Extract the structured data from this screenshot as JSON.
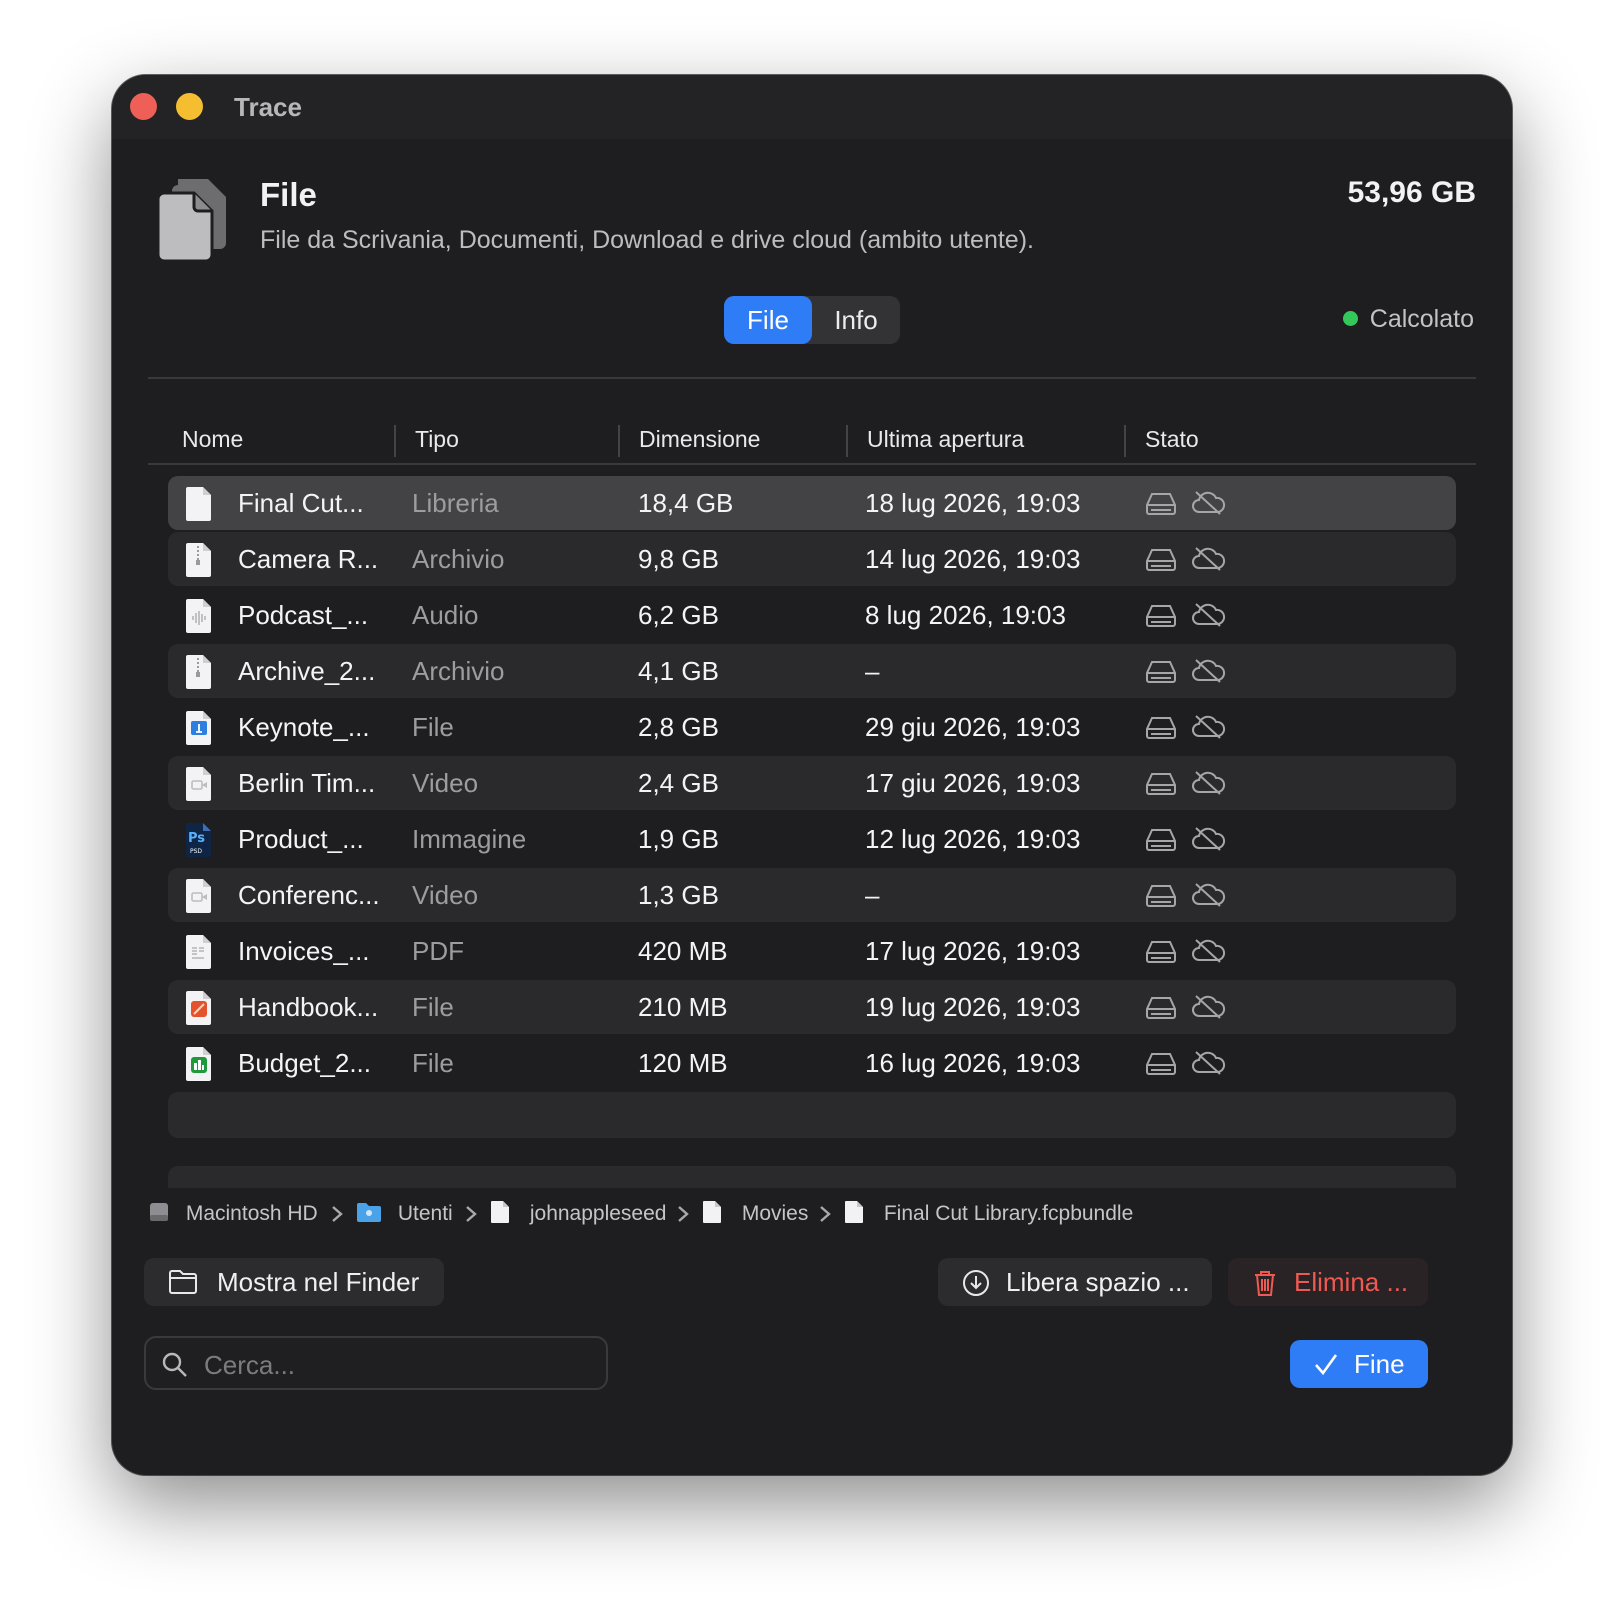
{
  "window": {
    "title": "Trace"
  },
  "header": {
    "title": "File",
    "subtitle": "File da Scrivania, Documenti, Download e drive cloud (ambito utente).",
    "total_size": "53,96 GB"
  },
  "tabs": [
    {
      "label": "File",
      "active": true
    },
    {
      "label": "Info",
      "active": false
    }
  ],
  "status": {
    "label": "Calcolato",
    "color": "#34c759"
  },
  "table": {
    "columns": [
      "Nome",
      "Tipo",
      "Dimensione",
      "Ultima apertura",
      "Stato"
    ],
    "rows": [
      {
        "name": "Final Cut...",
        "type": "Libreria",
        "size": "18,4 GB",
        "last_opened": "18 lug 2026, 19:03",
        "icon": "document-icon",
        "selected": true
      },
      {
        "name": "Camera R...",
        "type": "Archivio",
        "size": "9,8 GB",
        "last_opened": "14 lug 2026, 19:03",
        "icon": "archive-icon",
        "selected": false
      },
      {
        "name": "Podcast_...",
        "type": "Audio",
        "size": "6,2 GB",
        "last_opened": "8 lug 2026, 19:03",
        "icon": "audio-file-icon",
        "selected": false
      },
      {
        "name": "Archive_2...",
        "type": "Archivio",
        "size": "4,1 GB",
        "last_opened": "–",
        "icon": "archive-icon",
        "selected": false
      },
      {
        "name": "Keynote_...",
        "type": "File",
        "size": "2,8 GB",
        "last_opened": "29 giu 2026, 19:03",
        "icon": "keynote-icon",
        "selected": false
      },
      {
        "name": "Berlin Tim...",
        "type": "Video",
        "size": "2,4 GB",
        "last_opened": "17 giu 2026, 19:03",
        "icon": "video-file-icon",
        "selected": false
      },
      {
        "name": "Product_...",
        "type": "Immagine",
        "size": "1,9 GB",
        "last_opened": "12 lug 2026, 19:03",
        "icon": "psd-icon",
        "selected": false
      },
      {
        "name": "Conferenc...",
        "type": "Video",
        "size": "1,3 GB",
        "last_opened": "–",
        "icon": "video-file-icon",
        "selected": false
      },
      {
        "name": "Invoices_...",
        "type": "PDF",
        "size": "420 MB",
        "last_opened": "17 lug 2026, 19:03",
        "icon": "pdf-icon",
        "selected": false
      },
      {
        "name": "Handbook...",
        "type": "File",
        "size": "210 MB",
        "last_opened": "19 lug 2026, 19:03",
        "icon": "pages-icon",
        "selected": false
      },
      {
        "name": "Budget_2...",
        "type": "File",
        "size": "120 MB",
        "last_opened": "16 lug 2026, 19:03",
        "icon": "numbers-icon",
        "selected": false
      }
    ]
  },
  "breadcrumb": [
    {
      "label": "Macintosh HD",
      "icon": "hard-drive-icon"
    },
    {
      "label": "Utenti",
      "icon": "folder-icon"
    },
    {
      "label": "johnappleseed",
      "icon": "document-icon"
    },
    {
      "label": "Movies",
      "icon": "document-icon"
    },
    {
      "label": "Final Cut Library.fcpbundle",
      "icon": "document-icon"
    }
  ],
  "actions": {
    "show_in_finder": "Mostra nel Finder",
    "free_space": "Libera spazio ...",
    "delete": "Elimina ..."
  },
  "search": {
    "placeholder": "Cerca...",
    "value": ""
  },
  "done_button": "Fine",
  "colors": {
    "accent": "#2f7df6",
    "danger": "#ee5a52",
    "status_ok": "#34c759"
  }
}
